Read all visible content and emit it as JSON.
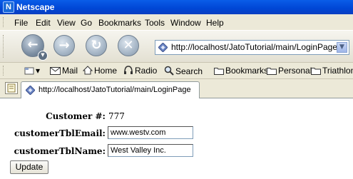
{
  "window": {
    "title": "Netscape",
    "app_icon_letter": "N"
  },
  "menu": [
    "File",
    "Edit",
    "View",
    "Go",
    "Bookmarks",
    "Tools",
    "Window",
    "Help"
  ],
  "nav": {
    "back_icon": "back-arrow-icon",
    "forward_icon": "forward-arrow-icon",
    "reload_icon": "reload-icon",
    "stop_icon": "stop-icon",
    "url": "http://localhost/JatoTutorial/main/LoginPage"
  },
  "personal_toolbar": {
    "items": [
      "Mail",
      "Home",
      "Radio",
      "Search",
      "Bookmarks",
      "Personal",
      "Triathlon"
    ]
  },
  "tab": {
    "label": "http://localhost/JatoTutorial/main/LoginPage"
  },
  "form": {
    "customer_num_label": "Customer #:",
    "customer_num_value": "777",
    "email_label": "customerTblEmail:",
    "email_value": "www.westv.com",
    "name_label": "customerTblName:",
    "name_value": "West Valley Inc.",
    "update_label": "Update"
  },
  "colors": {
    "title_bar": "#0046d5",
    "chrome": "#ece9d8",
    "url_border": "#7f9db9"
  }
}
